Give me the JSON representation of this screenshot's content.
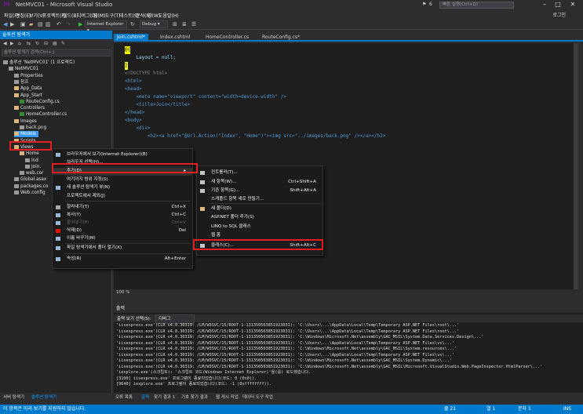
{
  "window": {
    "title": "NetMVC01 - Microsoft Visual Studio",
    "quick_launch": "빠른 실행(Ctrl+Q)",
    "flag_count": "6",
    "login": "로그인"
  },
  "menu": [
    "파일(F)",
    "편집(E)",
    "보기(V)",
    "프로젝트(P)",
    "빌드(B)",
    "디버그(D)",
    "팀(M)",
    "도구(T)",
    "테스트(S)",
    "분석(N)",
    "창(W)",
    "도움말(H)"
  ],
  "toolbar": {
    "browser": "Internet Explorer ▾",
    "config": "Debug ▾"
  },
  "solution_explorer": {
    "title": "솔루션 탐색기",
    "search_placeholder": "솔루션 탐색기 검색(Ctrl+;)",
    "items": [
      {
        "label": "솔루션 'NetMVC01' (1 프로젝트)",
        "icon": "solution",
        "indent": 0
      },
      {
        "label": "NetMVC01",
        "icon": "project",
        "indent": 1
      },
      {
        "label": "Properties",
        "icon": "prop",
        "indent": 2
      },
      {
        "label": "참조",
        "icon": "prop",
        "indent": 2
      },
      {
        "label": "App_Data",
        "icon": "folder",
        "indent": 2
      },
      {
        "label": "App_Start",
        "icon": "folder",
        "indent": 2
      },
      {
        "label": "RouteConfig.cs",
        "icon": "cs",
        "indent": 3
      },
      {
        "label": "Controllers",
        "icon": "folder",
        "indent": 2
      },
      {
        "label": "HomeController.cs",
        "icon": "cs",
        "indent": 3
      },
      {
        "label": "Images",
        "icon": "folder",
        "indent": 2
      },
      {
        "label": "back.png",
        "icon": "prop",
        "indent": 3
      },
      {
        "label": "Models",
        "icon": "folder",
        "indent": 2
      },
      {
        "label": "Scripts",
        "icon": "folder",
        "indent": 2
      },
      {
        "label": "Views",
        "icon": "folder",
        "indent": 2
      },
      {
        "label": "Home",
        "icon": "folder",
        "indent": 3
      },
      {
        "label": "Ind",
        "icon": "prop",
        "indent": 4
      },
      {
        "label": "Join.",
        "icon": "prop",
        "indent": 4
      },
      {
        "label": "web.cor",
        "icon": "prop",
        "indent": 3
      },
      {
        "label": "Global.asax",
        "icon": "prop",
        "indent": 2
      },
      {
        "label": "packages.co",
        "icon": "prop",
        "indent": 2
      },
      {
        "label": "Web.config",
        "icon": "prop",
        "indent": 2
      }
    ]
  },
  "tabs": [
    {
      "label": "Join.cshtml*",
      "active": true
    },
    {
      "label": "Index.cshtml",
      "active": false
    },
    {
      "label": "HomeController.cs",
      "active": false
    },
    {
      "label": "RouteConfig.cs*",
      "active": false
    }
  ],
  "editor": {
    "lines": [
      "@{",
      "    Layout = null;",
      "}",
      "",
      "<!DOCTYPE html>",
      "",
      "<html>",
      "<head>",
      "    <meta name=\"viewport\" content=\"width=device-width\" />",
      "    <title>Join</title>",
      "</head>",
      "<body>",
      "    <div>",
      "        <h2><a href=\"@Url.Action(\"Index\", \"Home\")\"><img src=\"../images/back.png\" /></a></h2>"
    ],
    "zoom": "100 %"
  },
  "context_menu": {
    "items": [
      {
        "label": "브라우저에서 보기(Internet Explorer)(B)",
        "shortcut": "",
        "disabled": false
      },
      {
        "label": "브라우저 선택(H)...",
        "shortcut": "",
        "disabled": false
      },
      {
        "label": "추가(D)",
        "shortcut": "",
        "disabled": false,
        "submenu": true
      },
      {
        "label": "여기까지 범위 지정(S)",
        "shortcut": "",
        "disabled": false
      },
      {
        "label": "새 솔루션 탐색기 뷰(N)",
        "shortcut": "",
        "disabled": false
      },
      {
        "label": "프로젝트에서 제외(J)",
        "shortcut": "",
        "disabled": false
      },
      {
        "label": "잘라내기(T)",
        "shortcut": "Ctrl+X",
        "disabled": false
      },
      {
        "label": "복사(Y)",
        "shortcut": "Ctrl+C",
        "disabled": false
      },
      {
        "label": "붙여넣기(P)",
        "shortcut": "Ctrl+V",
        "disabled": true
      },
      {
        "label": "삭제(D)",
        "shortcut": "Del",
        "disabled": false
      },
      {
        "label": "이름 바꾸기(M)",
        "shortcut": "",
        "disabled": false
      },
      {
        "label": "파일 탐색기에서 폴더 열기(X)",
        "shortcut": "",
        "disabled": false
      },
      {
        "label": "속성(R)",
        "shortcut": "Alt+Enter",
        "disabled": false
      }
    ]
  },
  "submenu": {
    "items": [
      {
        "label": "컨트롤러(T)...",
        "shortcut": ""
      },
      {
        "label": "새 항목(W)...",
        "shortcut": "Ctrl+Shift+A"
      },
      {
        "label": "기존 항목(G)...",
        "shortcut": "Shift+Alt+A"
      },
      {
        "label": "스캐폴드 항목 새로 만들기...",
        "shortcut": ""
      },
      {
        "label": "새 폴더(D)",
        "shortcut": ""
      },
      {
        "label": "ASP.NET 폴더 추가(S)",
        "shortcut": ""
      },
      {
        "label": "LINQ to SQL 클래스",
        "shortcut": ""
      },
      {
        "label": "웹 폼",
        "shortcut": ""
      },
      {
        "label": "클래스(C)...",
        "shortcut": "Shift+Alt+C"
      }
    ]
  },
  "output": {
    "title": "출력",
    "source_label": "출력 보기 선택(S):",
    "source_value": "디버그",
    "lines": [
      "'iisexpress.exe'(CLR v4.0.30319: /LM/W3SVC/15/ROOT-1-131350503851923031): 'C:\\Users\\...\\AppData\\Local\\Temp\\Temporary ASP.NET Files\\root\\...'",
      "'iisexpress.exe'(CLR v4.0.30319: /LM/W3SVC/15/ROOT-1-131350503851923031): 'C:\\Users\\...\\AppData\\Local\\Temp\\Temporary ASP.NET Files\\root\\...'",
      "'iisexpress.exe'(CLR v4.0.30319: /LM/W3SVC/15/ROOT-1-131350503851923031): 'C:\\Windows\\Microsoft.Net\\assembly\\GAC_MSIL\\System.Data.Services.Design\\...'",
      "'iisexpress.exe'(CLR v4.0.30319: /LM/W3SVC/15/ROOT-1-131350503851923031): 'C:\\Users\\...\\AppData\\Local\\Temp\\Temporary ASP.NET Files\\vs\\...'",
      "'iisexpress.exe'(CLR v4.0.30319: /LM/W3SVC/15/ROOT-1-131350503851923031): 'C:\\Windows\\Microsoft.Net\\assembly\\GAC_MSIL\\System.resources\\...'",
      "'iisexpress.exe'(CLR v4.0.30319: /LM/W3SVC/15/ROOT-1-131350503851923031): 'C:\\Users\\...\\AppData\\Local\\Temp\\Temporary ASP.NET Files\\vs\\...'",
      "'iisexpress.exe'(CLR v4.0.30319: /LM/W3SVC/15/ROOT-1-131350503851923031): 'C:\\Windows\\Microsoft.Net\\assembly\\GAC_MSIL\\System.Dynamic\\...'",
      "'iisexpress.exe'(CLR v4.0.30319: /LM/W3SVC/15/ROOT-1-131350503851923031): 'C:\\Windows\\Microsoft.Net\\assembly\\GAC_MSIL\\Microsoft.VisualStudio.Web.PageInspector.HtmlParser\\...'",
      "'iexplore.exe'(스크립트): '스크립트 코드(Windows Internet Explorer)'을(를) 로드했습니다.",
      "[3100] iisexpress.exe' 프로그램이 종료되었습니다(코드: 0 (0x0)).",
      "[9640] iexplore.exe' 프로그램이 종료되었습니다(코드: -1 (0xffffffff))."
    ]
  },
  "bottom_tabs_left": [
    "서버 탐색기",
    "솔루션 탐색기"
  ],
  "bottom_tabs": [
    "오류 목록",
    "출력",
    "찾기 결과 1",
    "기호 찾기 결과",
    "웹 게시 작업",
    "데이터 도구 작업"
  ],
  "status": {
    "message": "이 항목은 미리 보기를 지원하지 않습니다.",
    "line": "줄 21",
    "col": "열 1",
    "ch": "문자 1",
    "mode": "INS"
  }
}
